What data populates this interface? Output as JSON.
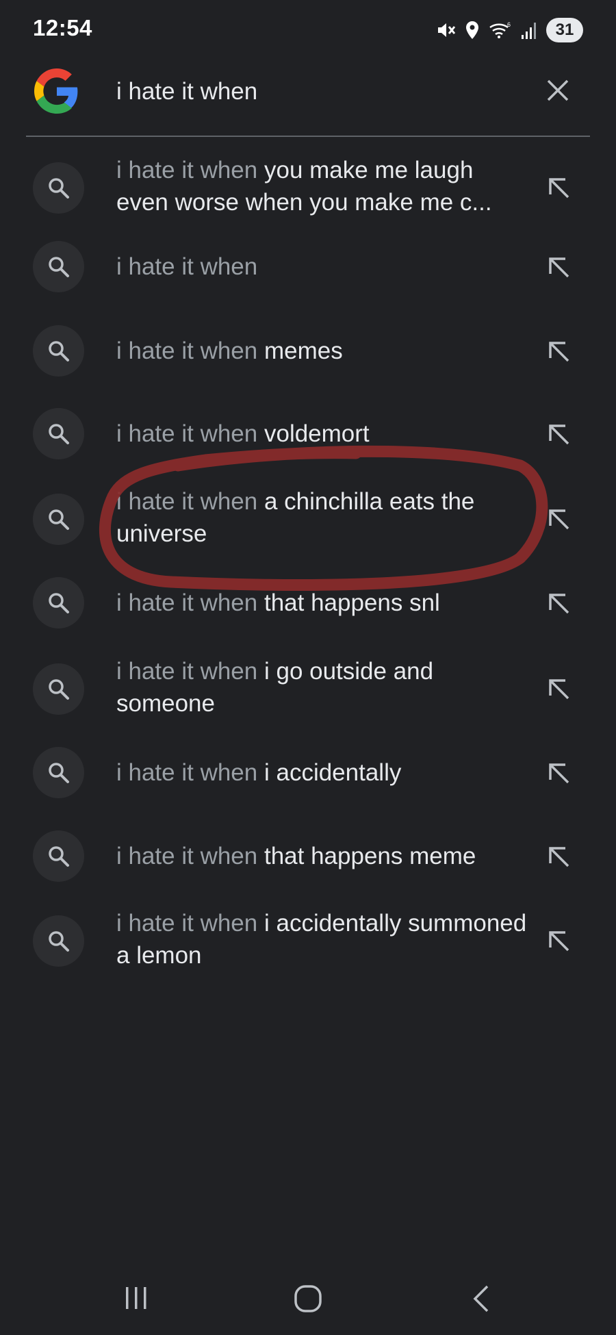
{
  "status": {
    "time": "12:54",
    "battery": "31",
    "icons": [
      "mute-icon",
      "location-icon",
      "wifi-icon",
      "signal-icon"
    ]
  },
  "search": {
    "query": "i hate it when",
    "logo": "google-g-logo",
    "clear_icon": "close-icon"
  },
  "suggestions": [
    {
      "prefix": "i hate it when",
      "rest": " you make me laugh even worse when you make me c..."
    },
    {
      "prefix": "i hate it when",
      "rest": ""
    },
    {
      "prefix": "i hate it when",
      "rest": " memes"
    },
    {
      "prefix": "i hate it when",
      "rest": " voldemort"
    },
    {
      "prefix": "i hate it when",
      "rest": " a chinchilla eats the universe"
    },
    {
      "prefix": "i hate it when",
      "rest": " that happens snl"
    },
    {
      "prefix": "i hate it when",
      "rest": " i go outside and someone"
    },
    {
      "prefix": "i hate it when",
      "rest": " i accidentally"
    },
    {
      "prefix": "i hate it when",
      "rest": " that happens meme"
    },
    {
      "prefix": "i hate it when",
      "rest": " i accidentally summoned a lemon"
    }
  ],
  "annotation": {
    "color": "#8b2b2b",
    "target": "suggestion-5"
  },
  "nav": {
    "buttons": [
      "recent-apps-icon",
      "home-icon",
      "back-icon"
    ]
  }
}
